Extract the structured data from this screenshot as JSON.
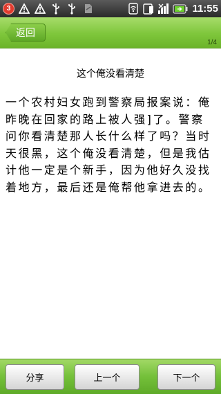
{
  "status_bar": {
    "notification_count": "3",
    "time": "11:55",
    "icons": [
      "warning-icon",
      "warning-icon",
      "usb-icon",
      "usb-icon",
      "sd-card-icon",
      "wifi-icon",
      "data-icon",
      "signal-icon",
      "battery-icon"
    ]
  },
  "title_bar": {
    "back_label": "返回",
    "page_indicator": "1/4"
  },
  "article": {
    "title": "这个俺没看清楚",
    "body": "一个农村妇女跑到警察局报案说：俺昨晚在回家的路上被人强]了。警察问你看清楚那人长什么样了吗？当时天很黑，这个俺没看清楚，但是我估计他一定是个新手，因为他好久没找着地方，最后还是俺帮他拿进去的。"
  },
  "bottom_bar": {
    "share_label": "分享",
    "prev_label": "上一个",
    "next_label": "下一个"
  },
  "colors": {
    "accent_green": "#7ec63b",
    "badge_red": "#e23b2e"
  }
}
